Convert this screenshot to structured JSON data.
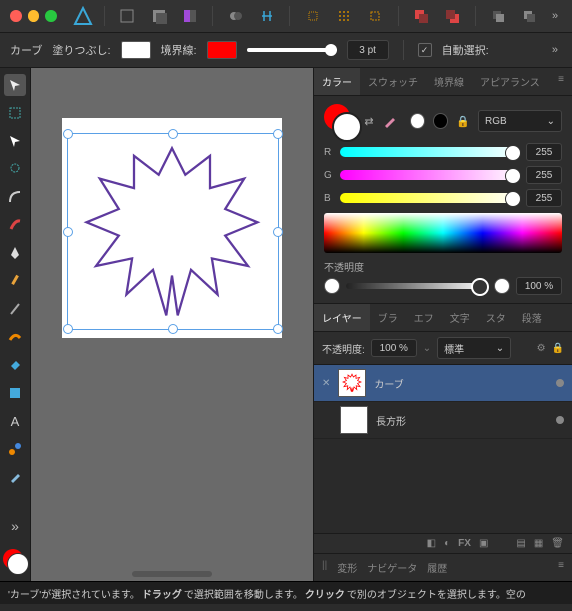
{
  "titlebar": {
    "traffic": [
      "close",
      "min",
      "max"
    ]
  },
  "optbar": {
    "object_type": "カーブ",
    "fill_label": "塗りつぶし:",
    "fill_color": "#ffffff",
    "stroke_label": "境界線:",
    "stroke_color": "#ff0000",
    "stroke_width": "3 pt",
    "autoselect_label": "自動選択:"
  },
  "tools": [
    "move",
    "marquee",
    "node",
    "lasso",
    "corner",
    "paintbrush",
    "pen",
    "pencil",
    "stylus",
    "vector-brush",
    "fill",
    "shape",
    "text",
    "gradient",
    "transparency",
    "colorpicker"
  ],
  "color_panel": {
    "tabs": [
      "カラー",
      "スウォッチ",
      "境界線",
      "アピアランス"
    ],
    "active_tab": 0,
    "mode": "RGB",
    "r": {
      "label": "R",
      "value": "255"
    },
    "g": {
      "label": "G",
      "value": "255"
    },
    "b": {
      "label": "B",
      "value": "255"
    },
    "opacity_label": "不透明度",
    "opacity_value": "100 %"
  },
  "layer_panel": {
    "tabs": [
      "レイヤー",
      "ブラ",
      "エフ",
      "文字",
      "スタ",
      "段落"
    ],
    "active_tab": 0,
    "opacity_label": "不透明度:",
    "opacity_value": "100 %",
    "blend_mode": "標準",
    "layers": [
      {
        "name": "カーブ",
        "selected": true,
        "thumb": "flower"
      },
      {
        "name": "長方形",
        "selected": false,
        "thumb": "rect"
      }
    ],
    "foot_icons": [
      "mask",
      "adjust",
      "fx",
      "merge",
      "group",
      "add",
      "delete"
    ],
    "fx_label": "FX"
  },
  "bottom_tabs": [
    "変形",
    "ナビゲータ",
    "履歴"
  ],
  "status": {
    "text_pre": "'カーブ'が選択されています。",
    "bold1": "ドラッグ",
    "text_mid": "で選択範囲を移動します。",
    "bold2": "クリック",
    "text_post": "で別のオブジェクトを選択します。空の"
  },
  "canvas": {
    "flower_stroke": "#5e3a9e"
  }
}
